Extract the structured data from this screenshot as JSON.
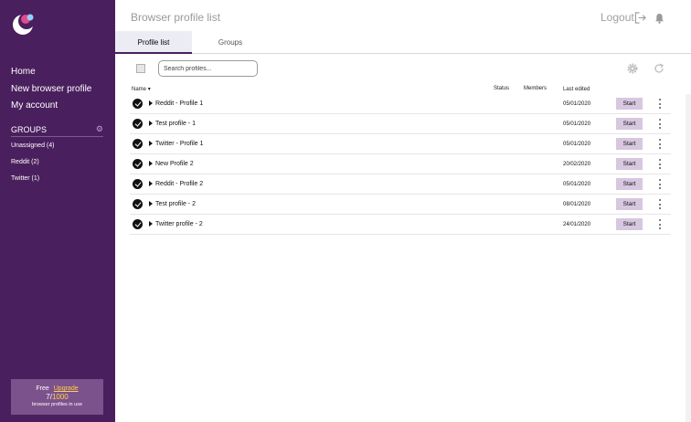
{
  "sidebar": {
    "nav": [
      {
        "label": "Home"
      },
      {
        "label": "New browser profile"
      },
      {
        "label": "My account"
      }
    ],
    "groups_title": "GROUPS",
    "groups": [
      {
        "label": "Unassigned (4)"
      },
      {
        "label": "Reddit (2)"
      },
      {
        "label": "Twitter (1)"
      }
    ],
    "plan": {
      "name": "Free",
      "upgrade_label": "Upgrade",
      "used": "7",
      "max": "1000",
      "note": "browser profiles in use"
    }
  },
  "header": {
    "title": "Browser profile list",
    "logout_label": "Logout"
  },
  "tabs": [
    {
      "label": "Profile list",
      "active": true
    },
    {
      "label": "Groups",
      "active": false
    }
  ],
  "search": {
    "placeholder": "Search profiles..."
  },
  "table": {
    "columns": {
      "name": "Name",
      "status": "Status",
      "members": "Members",
      "last_edited": "Last edited"
    },
    "rows": [
      {
        "name": "Reddit - Profile 1",
        "last_edited": "05/01/2020",
        "action": "Start"
      },
      {
        "name": "Test profile - 1",
        "last_edited": "05/01/2020",
        "action": "Start"
      },
      {
        "name": "Twitter - Profile 1",
        "last_edited": "05/01/2020",
        "action": "Start"
      },
      {
        "name": "New Profile 2",
        "last_edited": "20/02/2020",
        "action": "Start"
      },
      {
        "name": "Reddit - Profile 2",
        "last_edited": "05/01/2020",
        "action": "Start"
      },
      {
        "name": "Test profile - 2",
        "last_edited": "08/01/2020",
        "action": "Start"
      },
      {
        "name": "Twitter profile - 2",
        "last_edited": "24/01/2020",
        "action": "Start"
      }
    ]
  },
  "icons": {
    "logo": "app-logo",
    "logout": "logout-icon",
    "notifications": "bell-icon",
    "settings": "gear-icon",
    "refresh": "refresh-icon",
    "groups_settings": "gear-icon"
  },
  "colors": {
    "sidebar_bg": "#4a1f5e",
    "accent": "#d7c7e0",
    "upgrade": "#ffd24a"
  }
}
